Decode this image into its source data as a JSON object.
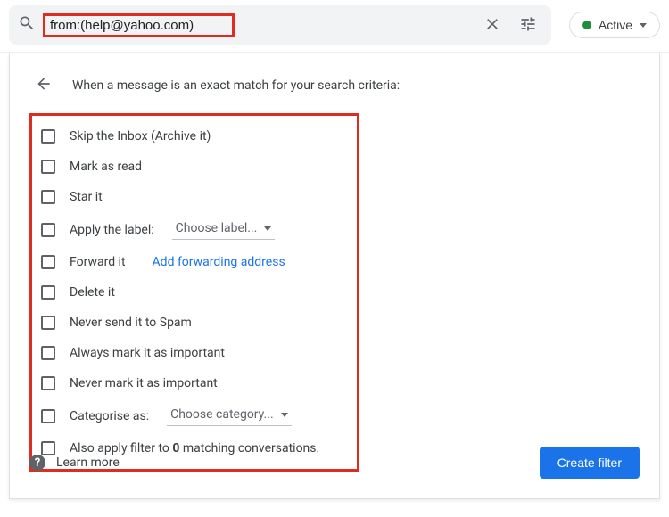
{
  "search": {
    "query": "from:(help@yahoo.com)"
  },
  "status_pill": {
    "label": "Active"
  },
  "panel": {
    "header_text": "When a message is an exact match for your search criteria:"
  },
  "actions": {
    "skip_inbox": "Skip the Inbox (Archive it)",
    "mark_read": "Mark as read",
    "star": "Star it",
    "apply_label_prefix": "Apply the label:",
    "apply_label_dropdown": "Choose label...",
    "forward": "Forward it",
    "forward_link": "Add forwarding address",
    "delete": "Delete it",
    "never_spam": "Never send it to Spam",
    "mark_important": "Always mark it as important",
    "never_important": "Never mark it as important",
    "categorise_prefix": "Categorise as:",
    "categorise_dropdown": "Choose category...",
    "also_apply_prefix": "Also apply filter to ",
    "also_apply_count": "0",
    "also_apply_suffix": " matching conversations."
  },
  "footer": {
    "learn_more": "Learn more",
    "create_filter": "Create filter"
  }
}
